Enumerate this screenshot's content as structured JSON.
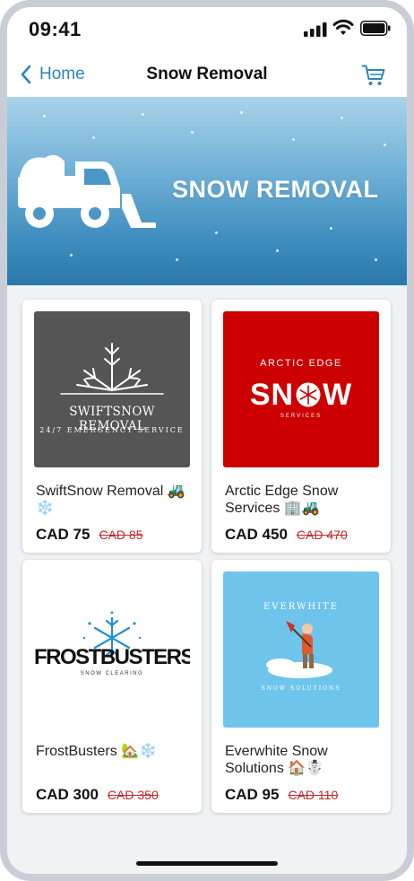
{
  "status_bar": {
    "time": "09:41"
  },
  "nav": {
    "back_label": "Home",
    "title": "Snow Removal"
  },
  "banner": {
    "title": "SNOW REMOVAL"
  },
  "products": [
    {
      "name": "SwiftSnow Removal 🚜❄️",
      "price": "CAD 75",
      "old_price": "CAD 85",
      "logo_title": "SWIFTSNOW REMOVAL",
      "logo_subtitle": "24/7 EMERGENCY SERVICE",
      "bg": "#555555"
    },
    {
      "name": "Arctic Edge Snow Services 🏢🚜",
      "price": "CAD 450",
      "old_price": "CAD 470",
      "logo_top": "ARCTIC EDGE",
      "logo_main_a": "SN",
      "logo_main_b": "W",
      "logo_sub": "SERVICES",
      "bg": "#cc0000"
    },
    {
      "name": "FrostBusters 🏡❄️",
      "price": "CAD 300",
      "old_price": "CAD 350",
      "logo_title": "FROSTBUSTERS",
      "logo_subtitle": "SNOW CLEARING",
      "bg": "#ffffff"
    },
    {
      "name": "Everwhite Snow Solutions 🏠☃️",
      "price": "CAD 95",
      "old_price": "CAD 110",
      "logo_title": "EVERWHITE",
      "logo_subtitle": "SNOW SOLUTIONS",
      "bg": "#6fc4ec"
    }
  ],
  "colors": {
    "accent": "#2c86b8",
    "sale": "#c2272d"
  }
}
